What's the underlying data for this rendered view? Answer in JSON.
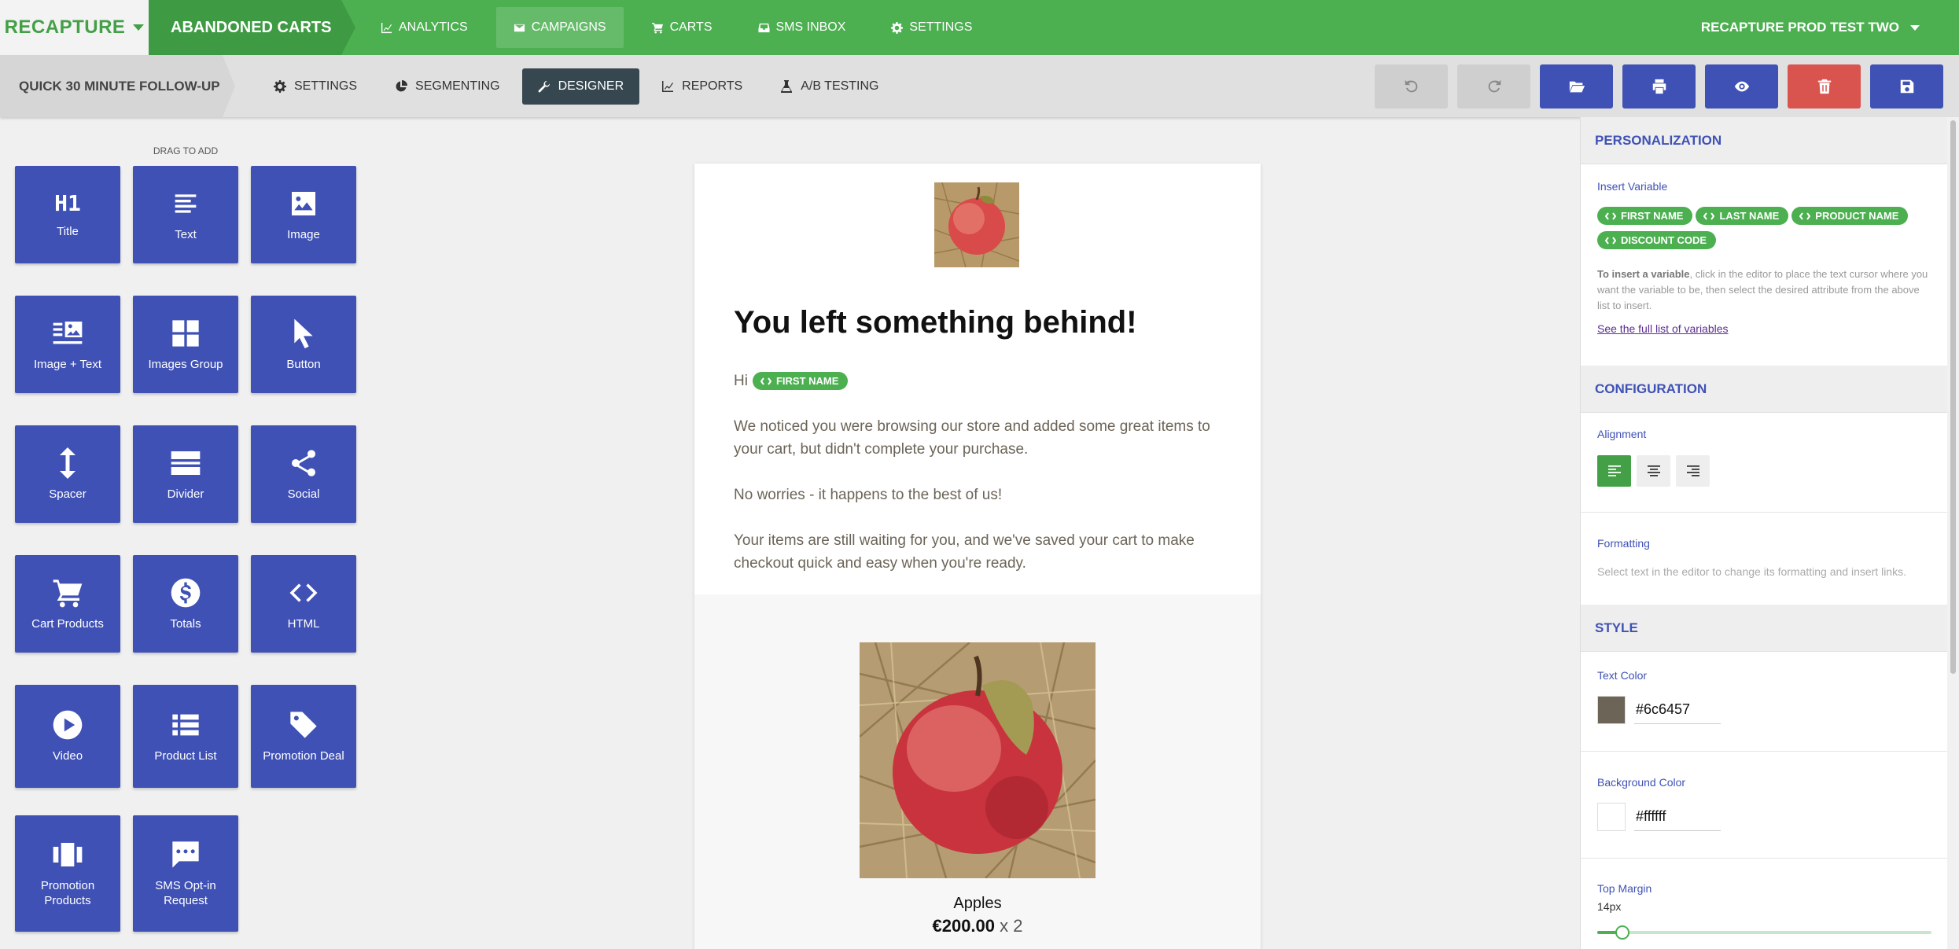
{
  "topbar": {
    "brand": "RECAPTURE",
    "section": "ABANDONED CARTS",
    "nav": [
      {
        "label": "ANALYTICS",
        "icon": "chart-line-icon"
      },
      {
        "label": "CAMPAIGNS",
        "icon": "envelope-icon"
      },
      {
        "label": "CARTS",
        "icon": "cart-icon"
      },
      {
        "label": "SMS INBOX",
        "icon": "inbox-icon"
      },
      {
        "label": "SETTINGS",
        "icon": "gear-icon"
      }
    ],
    "active_nav": "CAMPAIGNS",
    "account": "RECAPTURE PROD TEST TWO"
  },
  "subbar": {
    "campaign": "QUICK 30 MINUTE FOLLOW-UP",
    "tabs": [
      {
        "label": "SETTINGS",
        "icon": "gear-icon"
      },
      {
        "label": "SEGMENTING",
        "icon": "pie-chart-icon"
      },
      {
        "label": "DESIGNER",
        "icon": "wrench-icon"
      },
      {
        "label": "REPORTS",
        "icon": "chart-line-icon"
      },
      {
        "label": "A/B TESTING",
        "icon": "flask-icon"
      }
    ],
    "active_tab": "DESIGNER",
    "actions": [
      "undo-icon",
      "redo-icon",
      "folder-open-icon",
      "printer-icon",
      "eye-icon",
      "trash-icon",
      "save-icon"
    ],
    "colors": {
      "primary": "#3f51b5",
      "danger": "#d9534f",
      "disabled": "#cfcfcf"
    }
  },
  "palette": {
    "drag_label": "DRAG TO ADD",
    "tiles": [
      {
        "label": "Title",
        "icon": "h1-icon"
      },
      {
        "label": "Text",
        "icon": "text-lines-icon"
      },
      {
        "label": "Image",
        "icon": "image-icon"
      },
      {
        "label": "Image + Text",
        "icon": "image-text-icon"
      },
      {
        "label": "Images Group",
        "icon": "grid-icon"
      },
      {
        "label": "Button",
        "icon": "cursor-icon"
      },
      {
        "label": "Spacer",
        "icon": "vertical-arrows-icon"
      },
      {
        "label": "Divider",
        "icon": "divider-icon"
      },
      {
        "label": "Social",
        "icon": "share-icon"
      },
      {
        "label": "Cart Products",
        "icon": "cart-icon"
      },
      {
        "label": "Totals",
        "icon": "dollar-circle-icon"
      },
      {
        "label": "HTML",
        "icon": "code-icon"
      },
      {
        "label": "Video",
        "icon": "play-circle-icon"
      },
      {
        "label": "Product List",
        "icon": "list-icon"
      },
      {
        "label": "Promotion Deal",
        "icon": "tag-icon"
      },
      {
        "label": "Promotion Products",
        "icon": "carousel-icon"
      },
      {
        "label": "SMS Opt-in Request",
        "icon": "chat-icon"
      }
    ],
    "tile_color": "#3f51b5"
  },
  "email": {
    "headline": "You left something behind!",
    "greeting": "Hi",
    "greeting_chip": "FIRST NAME",
    "paragraphs": [
      "We noticed you were browsing our store and added some great items to your cart, but didn't complete your purchase.",
      "No worries - it happens to the best of us!",
      "Your items are still waiting for you, and we've saved your cart to make checkout quick and easy when you're ready."
    ],
    "product": {
      "name": "Apples",
      "price": "€200.00",
      "qty": "x 2"
    }
  },
  "panel": {
    "personalization": {
      "title": "PERSONALIZATION",
      "insert_label": "Insert Variable",
      "chips": [
        "FIRST NAME",
        "LAST NAME",
        "PRODUCT NAME",
        "DISCOUNT CODE"
      ],
      "help_bold": "To insert a variable",
      "help_rest": ", click in the editor to place the text cursor where you want the variable to be, then select the desired attribute from the above list to insert.",
      "link": "See the full list of variables"
    },
    "configuration": {
      "title": "CONFIGURATION",
      "alignment_label": "Alignment",
      "alignment": "left",
      "formatting_label": "Formatting",
      "formatting_hint": "Select text in the editor to change its formatting and insert links."
    },
    "style": {
      "title": "STYLE",
      "text_color_label": "Text Color",
      "text_color": "#6c6457",
      "background_color_label": "Background Color",
      "background_color": "#ffffff",
      "top_margin_label": "Top Margin",
      "top_margin_value": "14px",
      "top_margin_fraction": 0.075
    }
  },
  "colors": {
    "green": "#4caf50",
    "green_dark": "#3e9b43",
    "text": "#6c6457"
  }
}
